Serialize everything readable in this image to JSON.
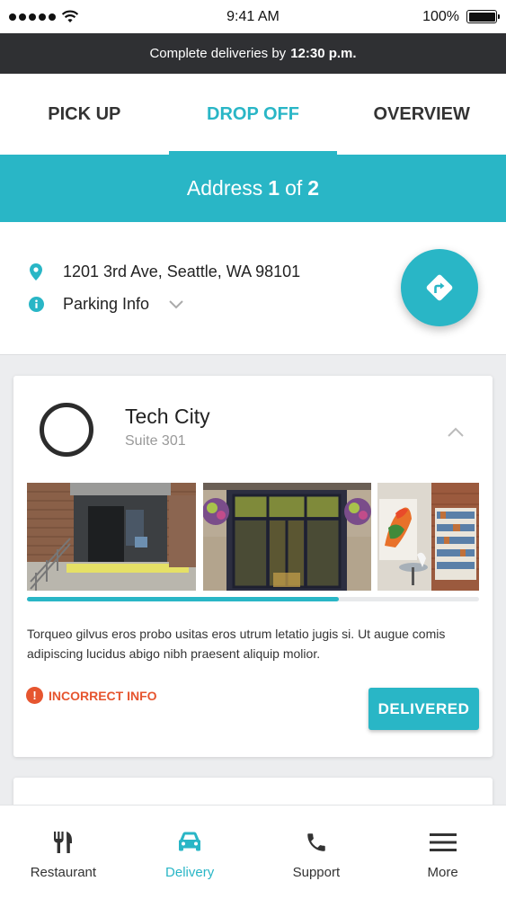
{
  "status_bar": {
    "time": "9:41 AM",
    "battery": "100%"
  },
  "banner": {
    "text": "Complete deliveries by",
    "deadline": "12:30 p.m."
  },
  "tabs": [
    {
      "label": "PICK UP",
      "active": false
    },
    {
      "label": "DROP OFF",
      "active": true
    },
    {
      "label": "OVERVIEW",
      "active": false
    }
  ],
  "address_header": {
    "prefix": "Address",
    "current": "1",
    "of": "of",
    "total": "2"
  },
  "address": {
    "line": "1201 3rd Ave, Seattle, WA 98101",
    "parking_label": "Parking Info",
    "navigate_icon": "directions-icon"
  },
  "stop": {
    "title": "Tech City",
    "subtitle": "Suite 301",
    "photo_progress": 0.69,
    "description": "Torqueo gilvus eros probo usitas eros utrum letatio jugis si. Ut augue comis adipiscing lucidus abigo nibh praesent aliquip molior.",
    "incorrect_label": "INCORRECT INFO",
    "delivered_label": "DELIVERED"
  },
  "bottom_nav": [
    {
      "label": "Restaurant",
      "icon": "fork-knife-icon",
      "active": false
    },
    {
      "label": "Delivery",
      "icon": "car-icon",
      "active": true
    },
    {
      "label": "Support",
      "icon": "phone-icon",
      "active": false
    },
    {
      "label": "More",
      "icon": "menu-icon",
      "active": false
    }
  ],
  "colors": {
    "accent": "#29b6c6",
    "banner": "#2f3033",
    "warning": "#e6552f"
  }
}
